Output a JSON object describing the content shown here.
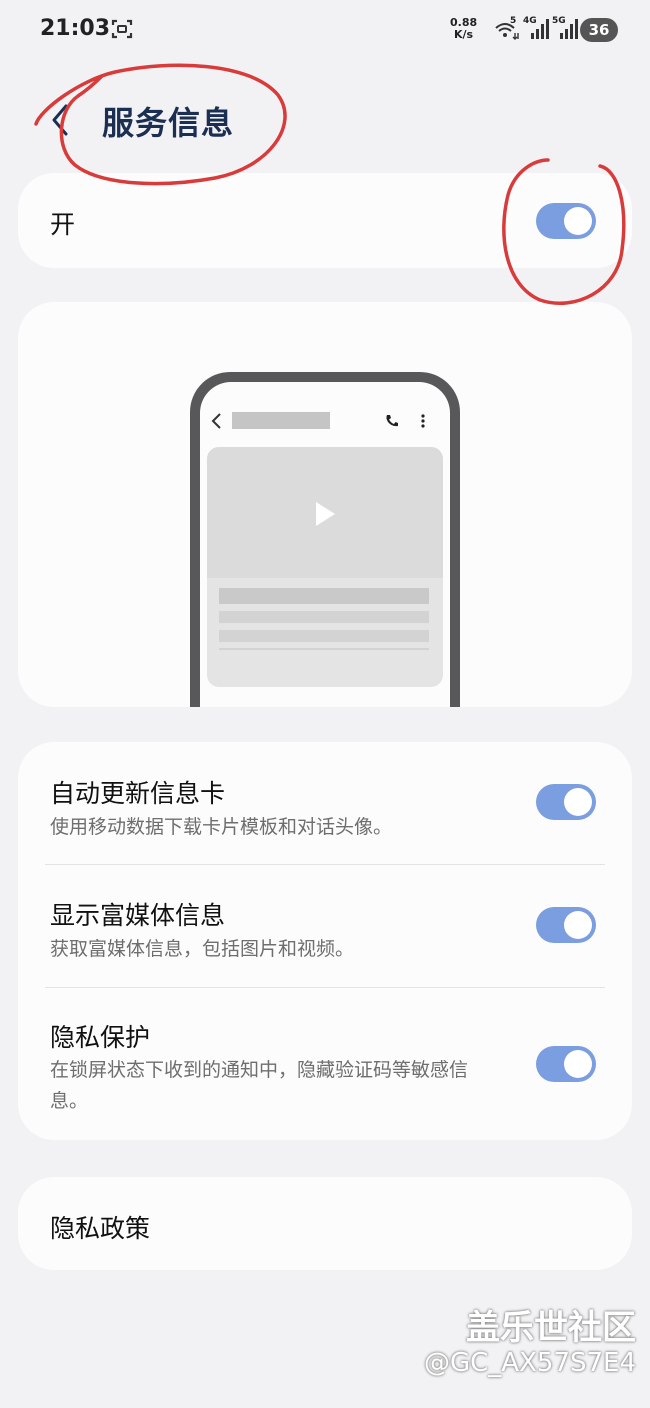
{
  "status_bar": {
    "time": "21:03",
    "speed_value": "0.88",
    "speed_unit": "K/s",
    "net1_label": "5",
    "net2_label": "4G",
    "net3_label": "5G",
    "battery": "36"
  },
  "header": {
    "title": "服务信息"
  },
  "master": {
    "label": "开",
    "enabled": true
  },
  "settings": [
    {
      "title": "自动更新信息卡",
      "description": "使用移动数据下载卡片模板和对话头像。",
      "enabled": true
    },
    {
      "title": "显示富媒体信息",
      "description": "获取富媒体信息，包括图片和视频。",
      "enabled": true
    },
    {
      "title": "隐私保护",
      "description": "在锁屏状态下收到的通知中，隐藏验证码等敏感信息。",
      "enabled": true
    }
  ],
  "privacy_policy": {
    "label": "隐私政策"
  },
  "watermark": {
    "brand": "盖乐世社区",
    "user": "@GC_AX57S7E4"
  },
  "colors": {
    "toggle_on": "#7a9ee0",
    "title": "#1b2f52",
    "annotation": "#d93a3a"
  }
}
